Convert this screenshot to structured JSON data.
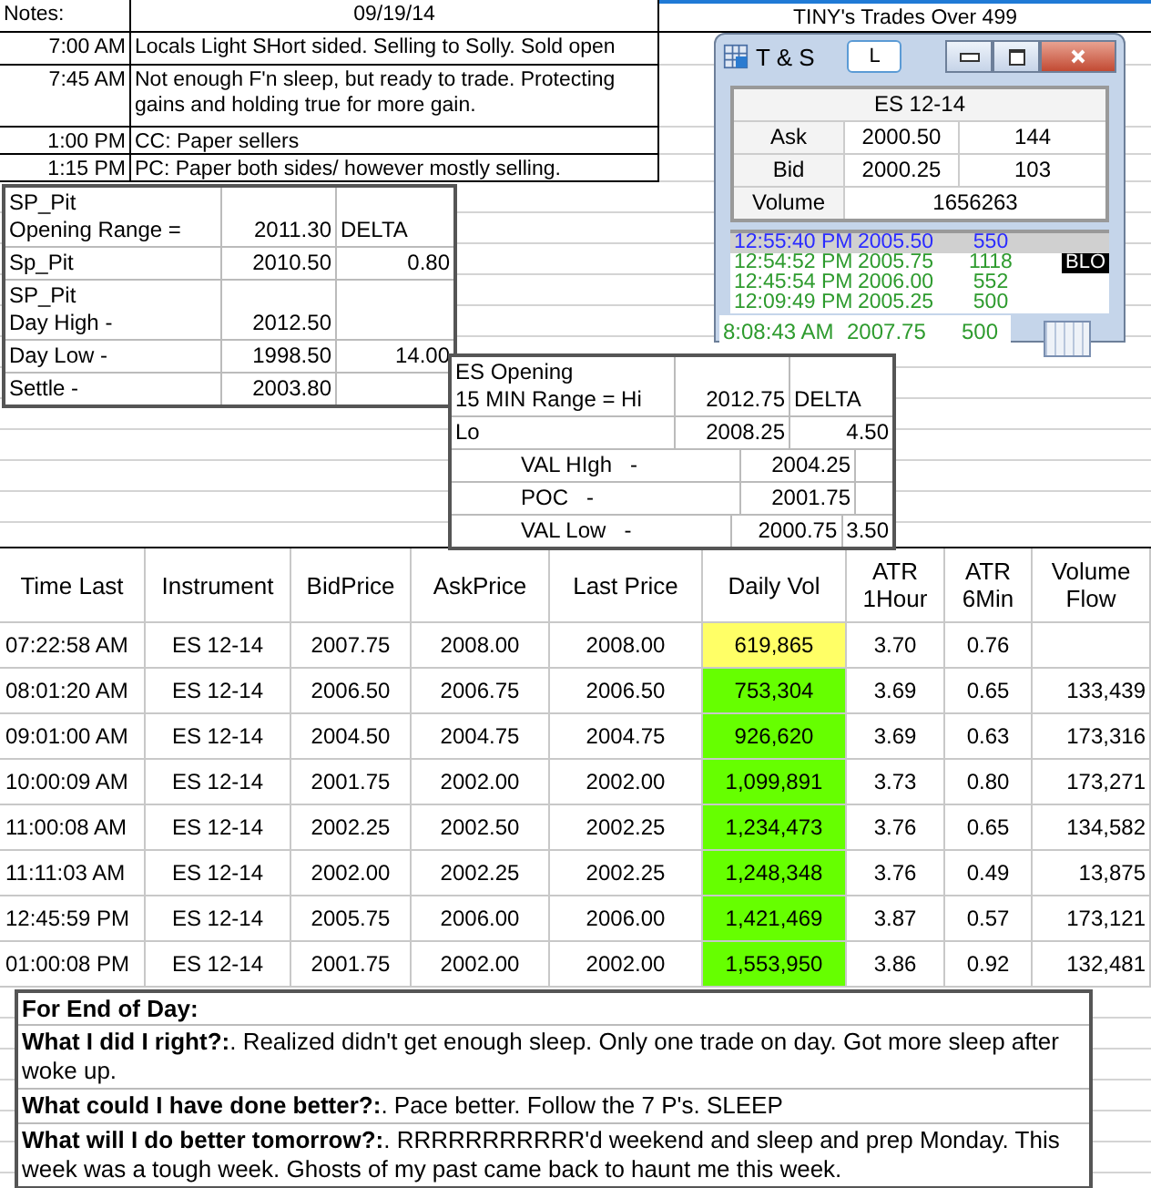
{
  "notes": {
    "label": "Notes:",
    "date": "09/19/14",
    "side_title": "TINY's Trades Over 499",
    "entries": [
      {
        "time": "7:00 AM",
        "text": "Locals Light SHort sided.  Selling to Solly. Sold open"
      },
      {
        "time": "7:45 AM",
        "text": "Not enough F'n sleep, but ready to trade.  Protecting gains and holding true for more gain."
      },
      {
        "time": "1:00 PM",
        "text": "CC: Paper sellers"
      },
      {
        "time": "1:15 PM",
        "text": "PC: Paper both sides/ however mostly selling."
      }
    ]
  },
  "sp_pit": {
    "rows": [
      {
        "label": [
          "SP_Pit",
          "Opening Range ="
        ],
        "value": "2011.30",
        "delta_label": "DELTA"
      },
      {
        "label": [
          "Sp_Pit"
        ],
        "value": "2010.50",
        "delta": "0.80"
      },
      {
        "label": [
          "SP_Pit",
          "Day High -"
        ],
        "value": "2012.50"
      },
      {
        "label": [
          "Day Low -"
        ],
        "value": "1998.50",
        "delta": "14.00"
      },
      {
        "label": [
          "Settle -"
        ],
        "value": "2003.80"
      }
    ]
  },
  "es_opening": {
    "rows": [
      {
        "label": [
          "ES Opening",
          "15 MIN Range = Hi"
        ],
        "indent": false,
        "value": "2012.75",
        "delta_label": "DELTA"
      },
      {
        "label": [
          "Lo"
        ],
        "indent": false,
        "value": "2008.25",
        "delta": "4.50"
      },
      {
        "label": [
          "VAL HIgh   -"
        ],
        "indent": true,
        "value": "2004.25"
      },
      {
        "label": [
          "POC   -"
        ],
        "indent": true,
        "value": "2001.75"
      },
      {
        "label": [
          "VAL Low   -"
        ],
        "indent": true,
        "value": "2000.75",
        "delta": "3.50"
      }
    ]
  },
  "ts_window": {
    "title": "T & S",
    "link_button": "L",
    "symbol": "ES 12-14",
    "quotes": [
      {
        "label": "Ask",
        "price": "2000.50",
        "size": "144"
      },
      {
        "label": "Bid",
        "price": "2000.25",
        "size": "103"
      }
    ],
    "volume_label": "Volume",
    "volume": "1656263",
    "trades": [
      {
        "time": "12:55:40 PM",
        "price": "2005.50",
        "size": "550",
        "color": "#2b2bff",
        "selected": true
      },
      {
        "time": "12:54:52 PM",
        "price": "2005.75",
        "size": "1118",
        "color": "#2e9b2e",
        "selected": false,
        "tag": "BLO"
      },
      {
        "time": "12:45:54 PM",
        "price": "2006.00",
        "size": "552",
        "color": "#2e9b2e",
        "selected": false
      },
      {
        "time": "12:09:49 PM",
        "price": "2005.25",
        "size": "500",
        "color": "#2e9b2e",
        "selected": false
      }
    ],
    "overlap_trade": {
      "time": "8:08:43 AM",
      "price": "2007.75",
      "size": "500",
      "color": "#2e9b2e"
    }
  },
  "table": {
    "columns": [
      "Time Last",
      "Instrument",
      "BidPrice",
      "AskPrice",
      "Last Price",
      "Daily Vol",
      "ATR 1Hour",
      "ATR 6Min",
      "Volume Flow"
    ],
    "rows": [
      {
        "time": "07:22:58 AM",
        "instrument": "ES 12-14",
        "bid": "2007.75",
        "ask": "2008.00",
        "last": "2008.00",
        "daily_vol": "619,865",
        "color": "#ffff66",
        "atr_1h": "3.70",
        "atr_6m": "0.76"
      },
      {
        "time": "08:01:20 AM",
        "instrument": "ES 12-14",
        "bid": "2006.50",
        "ask": "2006.75",
        "last": "2006.50",
        "daily_vol": "753,304",
        "color": "#66ff00",
        "atr_1h": "3.69",
        "atr_6m": "0.65",
        "flow": "133,439"
      },
      {
        "time": "09:01:00 AM",
        "instrument": "ES 12-14",
        "bid": "2004.50",
        "ask": "2004.75",
        "last": "2004.75",
        "daily_vol": "926,620",
        "color": "#66ff00",
        "atr_1h": "3.69",
        "atr_6m": "0.63",
        "flow": "173,316"
      },
      {
        "time": "10:00:09 AM",
        "instrument": "ES 12-14",
        "bid": "2001.75",
        "ask": "2002.00",
        "last": "2002.00",
        "daily_vol": "1,099,891",
        "color": "#66ff00",
        "atr_1h": "3.73",
        "atr_6m": "0.80",
        "flow": "173,271"
      },
      {
        "time": "11:00:08 AM",
        "instrument": "ES 12-14",
        "bid": "2002.25",
        "ask": "2002.50",
        "last": "2002.25",
        "daily_vol": "1,234,473",
        "color": "#66ff00",
        "atr_1h": "3.76",
        "atr_6m": "0.65",
        "flow": "134,582"
      },
      {
        "time": "11:11:03 AM",
        "instrument": "ES 12-14",
        "bid": "2002.00",
        "ask": "2002.25",
        "last": "2002.25",
        "daily_vol": "1,248,348",
        "color": "#66ff00",
        "atr_1h": "3.76",
        "atr_6m": "0.49",
        "flow": "13,875"
      },
      {
        "time": "12:45:59 PM",
        "instrument": "ES 12-14",
        "bid": "2005.75",
        "ask": "2006.00",
        "last": "2006.00",
        "daily_vol": "1,421,469",
        "color": "#66ff00",
        "atr_1h": "3.87",
        "atr_6m": "0.57",
        "flow": "173,121"
      },
      {
        "time": "01:00:08 PM",
        "instrument": "ES 12-14",
        "bid": "2001.75",
        "ask": "2002.00",
        "last": "2002.00",
        "daily_vol": "1,553,950",
        "color": "#66ff00",
        "atr_1h": "3.86",
        "atr_6m": "0.92",
        "flow": "132,481"
      }
    ]
  },
  "end_of_day": {
    "title": "For End of Day:",
    "items": [
      "**What I did I right?:**. Realized didn't get enough sleep.  Only one trade on day.  Got more sleep after woke up.",
      "**What could I have done better?:**. Pace better. Follow the 7 P's. SLEEP",
      "**What will I do better tomorrow?:**. RRRRRRRRRRR'd weekend and sleep and prep Monday.  This week was a tough week.  Ghosts of my past came back to haunt me this week."
    ]
  }
}
